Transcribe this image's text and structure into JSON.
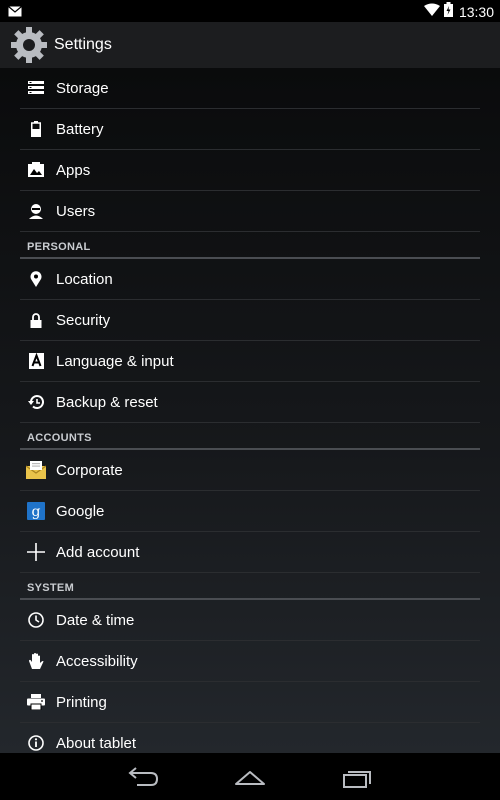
{
  "status_bar": {
    "time": "13:30",
    "notification_icon": "mail-icon",
    "wifi_icon": "wifi-icon",
    "battery_icon": "battery-charging-icon"
  },
  "action_bar": {
    "title": "Settings",
    "icon": "settings-gear-icon"
  },
  "device_items": [
    {
      "label": "Storage",
      "icon": "storage-icon"
    },
    {
      "label": "Battery",
      "icon": "battery-icon"
    },
    {
      "label": "Apps",
      "icon": "apps-icon"
    },
    {
      "label": "Users",
      "icon": "users-icon"
    }
  ],
  "sections": {
    "personal": {
      "header": "PERSONAL",
      "items": [
        {
          "label": "Location",
          "icon": "location-pin-icon"
        },
        {
          "label": "Security",
          "icon": "lock-icon"
        },
        {
          "label": "Language & input",
          "icon": "language-icon"
        },
        {
          "label": "Backup & reset",
          "icon": "backup-restore-icon"
        }
      ]
    },
    "accounts": {
      "header": "ACCOUNTS",
      "items": [
        {
          "label": "Corporate",
          "icon": "corporate-mail-icon"
        },
        {
          "label": "Google",
          "icon": "google-icon"
        },
        {
          "label": "Add account",
          "icon": "plus-icon"
        }
      ]
    },
    "system": {
      "header": "SYSTEM",
      "items": [
        {
          "label": "Date & time",
          "icon": "clock-icon"
        },
        {
          "label": "Accessibility",
          "icon": "hand-icon"
        },
        {
          "label": "Printing",
          "icon": "printer-icon"
        },
        {
          "label": "About tablet",
          "icon": "info-icon"
        }
      ]
    }
  },
  "nav_bar": {
    "back_icon": "back-icon",
    "home_icon": "home-icon",
    "recents_icon": "recent-apps-icon"
  },
  "colors": {
    "background": "#000000",
    "action_bar": "#1c1d1f",
    "header_text": "#c9ccd0",
    "divider": "#2b2d30"
  }
}
